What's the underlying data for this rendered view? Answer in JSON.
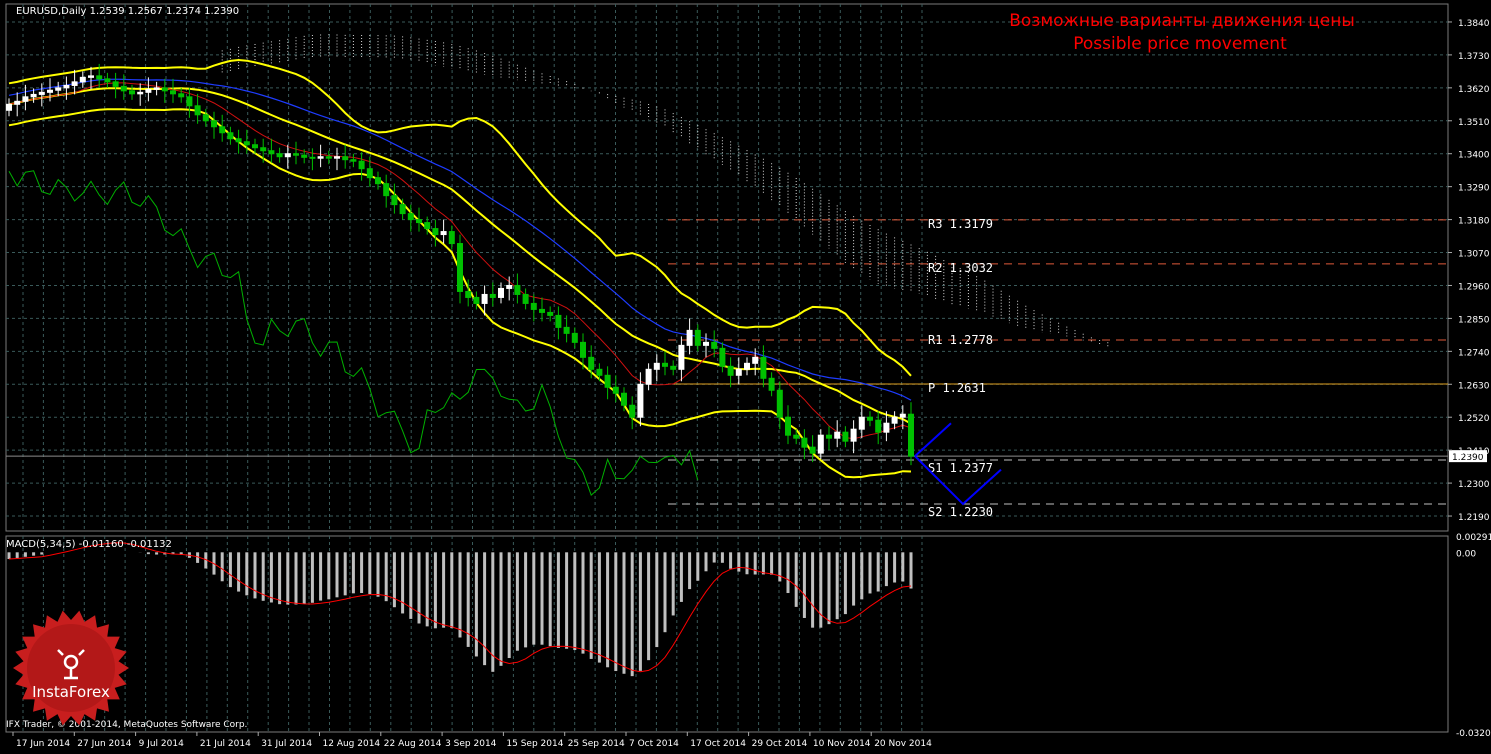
{
  "chart_data": [
    {
      "type": "candlestick",
      "header": "EURUSD,Daily  1.2539 1.2567 1.2374 1.2390",
      "symbol": "EURUSD",
      "timeframe": "Daily",
      "ohlc_last": {
        "open": 1.2539,
        "high": 1.2567,
        "low": 1.2374,
        "close": 1.239
      },
      "title": "Возможные варианты движения цены",
      "subtitle": "Possible price movement",
      "current_price_label": "1.2390",
      "current_price": 1.239,
      "ylim": [
        1.214,
        1.39
      ],
      "y_ticks": [
        "1.3840",
        "1.3730",
        "1.3620",
        "1.3510",
        "1.3400",
        "1.3290",
        "1.3180",
        "1.3070",
        "1.2960",
        "1.2850",
        "1.2740",
        "1.2630",
        "1.2520",
        "1.2410",
        "1.2300",
        "1.2190"
      ],
      "x_ticks": [
        "17 Jun 2014",
        "27 Jun 2014",
        "9 Jul 2014",
        "21 Jul 2014",
        "31 Jul 2014",
        "12 Aug 2014",
        "22 Aug 2014",
        "3 Sep 2014",
        "15 Sep 2014",
        "25 Sep 2014",
        "7 Oct 2014",
        "17 Oct 2014",
        "29 Oct 2014",
        "10 Nov 2014",
        "20 Nov 2014"
      ],
      "grid": true,
      "closes": [
        1.3565,
        1.3575,
        1.359,
        1.3598,
        1.3605,
        1.3612,
        1.362,
        1.3628,
        1.364,
        1.3655,
        1.366,
        1.365,
        1.364,
        1.3625,
        1.361,
        1.36,
        1.3605,
        1.3615,
        1.362,
        1.361,
        1.36,
        1.359,
        1.356,
        1.353,
        1.351,
        1.349,
        1.347,
        1.345,
        1.344,
        1.343,
        1.342,
        1.341,
        1.34,
        1.339,
        1.34,
        1.3395,
        1.3388,
        1.3385,
        1.339,
        1.3385,
        1.339,
        1.338,
        1.3375,
        1.335,
        1.332,
        1.33,
        1.326,
        1.323,
        1.32,
        1.318,
        1.317,
        1.315,
        1.313,
        1.314,
        1.31,
        1.294,
        1.292,
        1.29,
        1.293,
        1.292,
        1.295,
        1.296,
        1.293,
        1.29,
        1.288,
        1.287,
        1.286,
        1.282,
        1.28,
        1.277,
        1.272,
        1.268,
        1.266,
        1.262,
        1.26,
        1.256,
        1.252,
        1.263,
        1.268,
        1.27,
        1.269,
        1.268,
        1.276,
        1.281,
        1.276,
        1.277,
        1.275,
        1.269,
        1.266,
        1.268,
        1.27,
        1.272,
        1.265,
        1.261,
        1.252,
        1.246,
        1.245,
        1.242,
        1.24,
        1.246,
        1.245,
        1.247,
        1.244,
        1.248,
        1.252,
        1.251,
        1.247,
        1.25,
        1.252,
        1.253,
        1.239
      ],
      "lines": [
        {
          "name": "S1",
          "value": 1.2377,
          "label": "S1  1.2377",
          "style": "dashed",
          "color": "#c0c0c0"
        },
        {
          "name": "S2",
          "value": 1.223,
          "label": "S2  1.2230",
          "style": "dashed",
          "color": "#c0c0c0"
        },
        {
          "name": "P",
          "value": 1.2631,
          "label": "P  1.2631",
          "style": "solid",
          "color": "#e0a020"
        },
        {
          "name": "R1",
          "value": 1.2778,
          "label": "R1  1.2778",
          "style": "dashed",
          "color": "#e05a3a"
        },
        {
          "name": "R2",
          "value": 1.3032,
          "label": "R2  1.3032",
          "style": "dashed",
          "color": "#e05a3a"
        },
        {
          "name": "R3",
          "value": 1.3179,
          "label": "R3  1.3179",
          "style": "dashed",
          "color": "#e05a3a"
        }
      ],
      "colors": {
        "bull": "#ffffff",
        "bear": "#00c000",
        "bollinger": "#ffff00",
        "kijun": "#1e3cff",
        "tenkan": "#d01010",
        "chikou": "#00b000",
        "grid": "#3a5a5a",
        "title": "#ff0000",
        "projection": "#0000ff"
      }
    },
    {
      "type": "bar",
      "header": "MACD(5,34,5) -0.01160 -0.01132",
      "ylim": [
        -0.03205,
        0.00291
      ],
      "y_ticks": [
        "0.00291",
        "0.00",
        "-0.03205"
      ],
      "colors": {
        "histogram": "#c0c0c0",
        "signal": "#ff0000"
      }
    }
  ],
  "footer": "IFX Trader, © 2001-2014, MetaQuotes Software Corp.",
  "logo": {
    "text": "InstaForex",
    "color": "#c81e1e"
  }
}
